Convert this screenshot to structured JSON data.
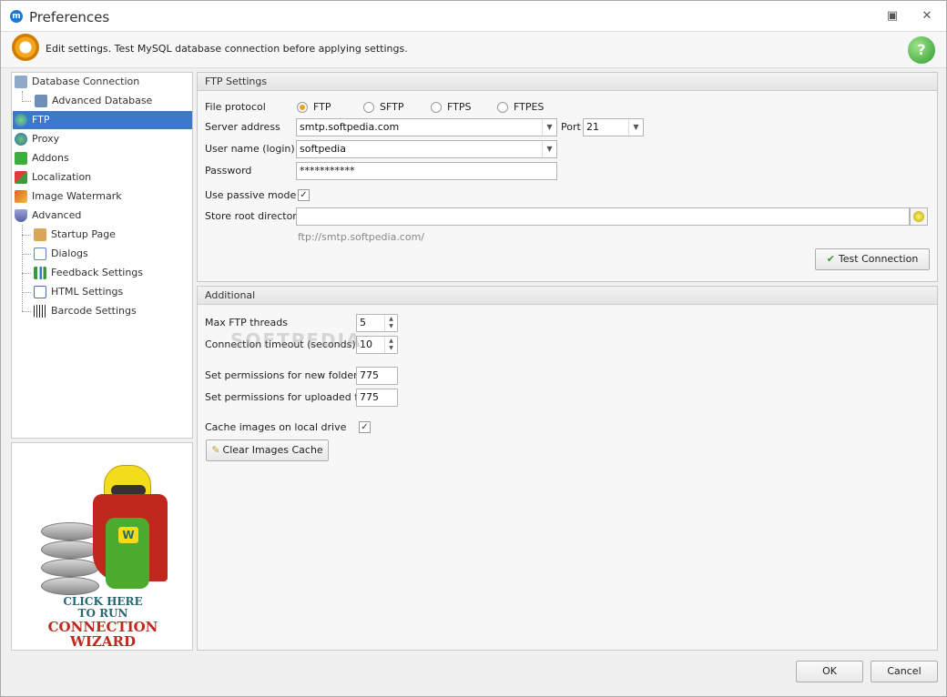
{
  "window": {
    "title": "Preferences",
    "app_icon": "m-logo-icon"
  },
  "header": {
    "text": "Edit settings. Test MySQL database connection before applying settings."
  },
  "tree": {
    "items": [
      {
        "label": "Database Connection",
        "icon": "database-icon"
      },
      {
        "label": "Advanced Database Settings",
        "icon": "database-settings-icon"
      },
      {
        "label": "FTP",
        "icon": "ftp-globe-icon",
        "selected": true
      },
      {
        "label": "Proxy",
        "icon": "proxy-globe-icon"
      },
      {
        "label": "Addons",
        "icon": "puzzle-icon"
      },
      {
        "label": "Localization",
        "icon": "localization-icon"
      },
      {
        "label": "Image Watermark",
        "icon": "watermark-icon"
      },
      {
        "label": "Advanced",
        "icon": "shield-icon"
      },
      {
        "label": "Startup Page",
        "icon": "home-icon"
      },
      {
        "label": "Dialogs",
        "icon": "dialog-icon"
      },
      {
        "label": "Feedback Settings",
        "icon": "chart-icon"
      },
      {
        "label": "HTML Settings",
        "icon": "html-icon"
      },
      {
        "label": "Barcode Settings",
        "icon": "barcode-icon"
      }
    ]
  },
  "promo": {
    "line1": "CLICK HERE",
    "line2": "TO RUN",
    "line3": "CONNECTION",
    "line4": "WIZARD"
  },
  "ftp": {
    "group_title": "FTP Settings",
    "protocol_label": "File protocol",
    "protocols": [
      "FTP",
      "SFTP",
      "FTPS",
      "FTPES"
    ],
    "selected_protocol": "FTP",
    "server_label": "Server address",
    "server_value": "smtp.softpedia.com",
    "port_label": "Port",
    "port_value": "21",
    "user_label": "User name (login)",
    "user_value": "softpedia",
    "password_label": "Password",
    "password_value": "***********",
    "passive_label": "Use passive mode",
    "passive_checked": true,
    "root_label": "Store root directory",
    "root_value": "",
    "url_hint": "ftp://smtp.softpedia.com/",
    "test_button": "Test Connection"
  },
  "additional": {
    "group_title": "Additional",
    "threads_label": "Max FTP threads",
    "threads_value": "5",
    "timeout_label": "Connection timeout (seconds)",
    "timeout_value": "10",
    "folder_perm_label": "Set permissions for new folders",
    "folder_perm_value": "775",
    "file_perm_label": "Set permissions for uploaded files",
    "file_perm_value": "775",
    "cache_label": "Cache images on local drive",
    "cache_checked": true,
    "clear_cache_button": "Clear Images Cache"
  },
  "footer": {
    "ok": "OK",
    "cancel": "Cancel"
  },
  "watermark": "SOFTPEDIA",
  "colors": {
    "selection": "#3c78c8",
    "radio_on": "#f0a020",
    "wizard_red": "#c0281e",
    "wizard_teal": "#2a6670"
  }
}
